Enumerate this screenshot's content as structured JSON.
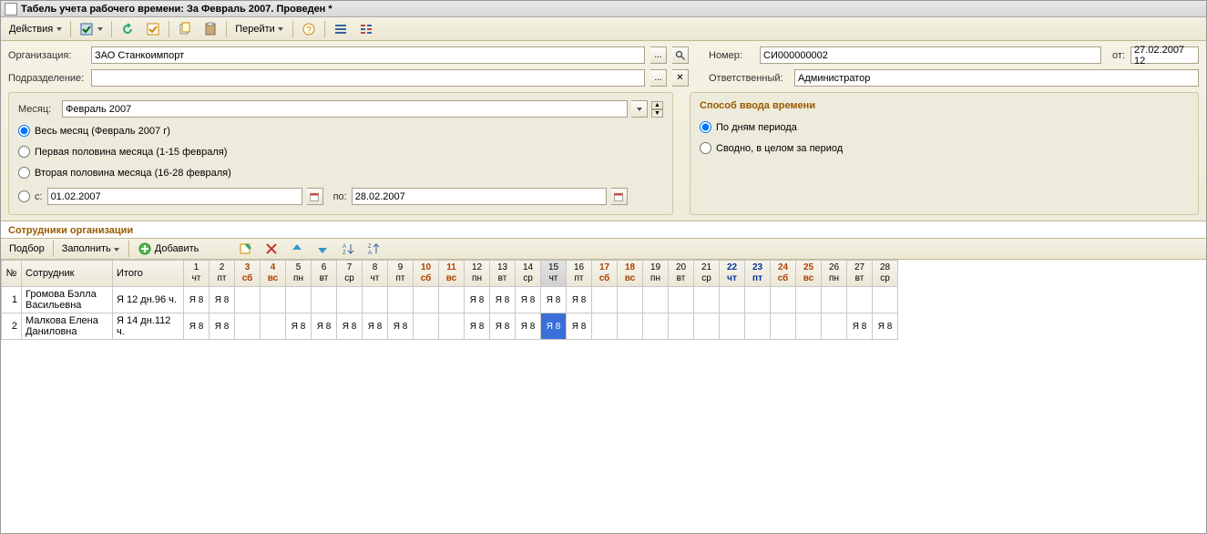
{
  "title": "Табель учета рабочего времени: За Февраль 2007. Проведен *",
  "toolbar": {
    "actions": "Действия",
    "go": "Перейти"
  },
  "form": {
    "org_label": "Организация:",
    "org_value": "ЗАО Станкоимпорт",
    "dept_label": "Подразделение:",
    "dept_value": "",
    "number_label": "Номер:",
    "number_value": "СИ000000002",
    "from_label": "от:",
    "from_value": "27.02.2007 12",
    "resp_label": "Ответственный:",
    "resp_value": "Администратор"
  },
  "month_block": {
    "month_label": "Месяц:",
    "month_value": "Февраль 2007",
    "opt_all": "Весь месяц (Февраль 2007 г)",
    "opt_first": "Первая половина месяца (1-15 февраля)",
    "opt_second": "Вторая половина месяца (16-28 февраля)",
    "opt_range": "с:",
    "date_from": "01.02.2007",
    "to_label": "по:",
    "date_to": "28.02.2007"
  },
  "mode_block": {
    "title": "Способ ввода времени",
    "opt_days": "По дням периода",
    "opt_summary": "Сводно, в целом за период"
  },
  "grid_section_title": "Сотрудники организации",
  "grid_toolbar": {
    "pick": "Подбор",
    "fill": "Заполнить",
    "add": "Добавить"
  },
  "headers": {
    "num": "№",
    "emp": "Сотрудник",
    "total": "Итого",
    "days": [
      {
        "n": "1",
        "w": "чт",
        "kind": "n"
      },
      {
        "n": "2",
        "w": "пт",
        "kind": "n"
      },
      {
        "n": "3",
        "w": "сб",
        "kind": "we"
      },
      {
        "n": "4",
        "w": "вс",
        "kind": "we"
      },
      {
        "n": "5",
        "w": "пн",
        "kind": "n"
      },
      {
        "n": "6",
        "w": "вт",
        "kind": "n"
      },
      {
        "n": "7",
        "w": "ср",
        "kind": "n"
      },
      {
        "n": "8",
        "w": "чт",
        "kind": "n"
      },
      {
        "n": "9",
        "w": "пт",
        "kind": "n"
      },
      {
        "n": "10",
        "w": "сб",
        "kind": "we"
      },
      {
        "n": "11",
        "w": "вс",
        "kind": "we"
      },
      {
        "n": "12",
        "w": "пн",
        "kind": "n"
      },
      {
        "n": "13",
        "w": "вт",
        "kind": "n"
      },
      {
        "n": "14",
        "w": "ср",
        "kind": "n"
      },
      {
        "n": "15",
        "w": "чт",
        "kind": "sel"
      },
      {
        "n": "16",
        "w": "пт",
        "kind": "n"
      },
      {
        "n": "17",
        "w": "сб",
        "kind": "we"
      },
      {
        "n": "18",
        "w": "вс",
        "kind": "we"
      },
      {
        "n": "19",
        "w": "пн",
        "kind": "n"
      },
      {
        "n": "20",
        "w": "вт",
        "kind": "n"
      },
      {
        "n": "21",
        "w": "ср",
        "kind": "n"
      },
      {
        "n": "22",
        "w": "чт",
        "kind": "today"
      },
      {
        "n": "23",
        "w": "пт",
        "kind": "today"
      },
      {
        "n": "24",
        "w": "сб",
        "kind": "we"
      },
      {
        "n": "25",
        "w": "вс",
        "kind": "we"
      },
      {
        "n": "26",
        "w": "пн",
        "kind": "n"
      },
      {
        "n": "27",
        "w": "вт",
        "kind": "n"
      },
      {
        "n": "28",
        "w": "ср",
        "kind": "n"
      }
    ]
  },
  "rows": [
    {
      "num": "1",
      "name": "Громова Бэлла Васильевна",
      "total": "Я 12 дн.96 ч.",
      "cells": [
        "Я 8",
        "Я 8",
        "",
        "",
        "",
        "",
        "",
        "",
        "",
        "",
        "",
        "Я 8",
        "Я 8",
        "Я 8",
        "Я 8",
        "Я 8",
        "",
        "",
        "",
        "",
        "",
        "",
        "",
        "",
        "",
        "",
        "",
        ""
      ]
    },
    {
      "num": "2",
      "name": "Малкова Елена Даниловна",
      "total": "Я 14 дн.112 ч.",
      "cells": [
        "Я 8",
        "Я 8",
        "",
        "",
        "Я 8",
        "Я 8",
        "Я 8",
        "Я 8",
        "Я 8",
        "",
        "",
        "Я 8",
        "Я 8",
        "Я 8",
        "Я 8",
        "Я 8",
        "",
        "",
        "",
        "",
        "",
        "",
        "",
        "",
        "",
        "",
        "Я 8",
        "Я 8"
      ]
    }
  ],
  "selected": {
    "row": 1,
    "col": 14
  }
}
